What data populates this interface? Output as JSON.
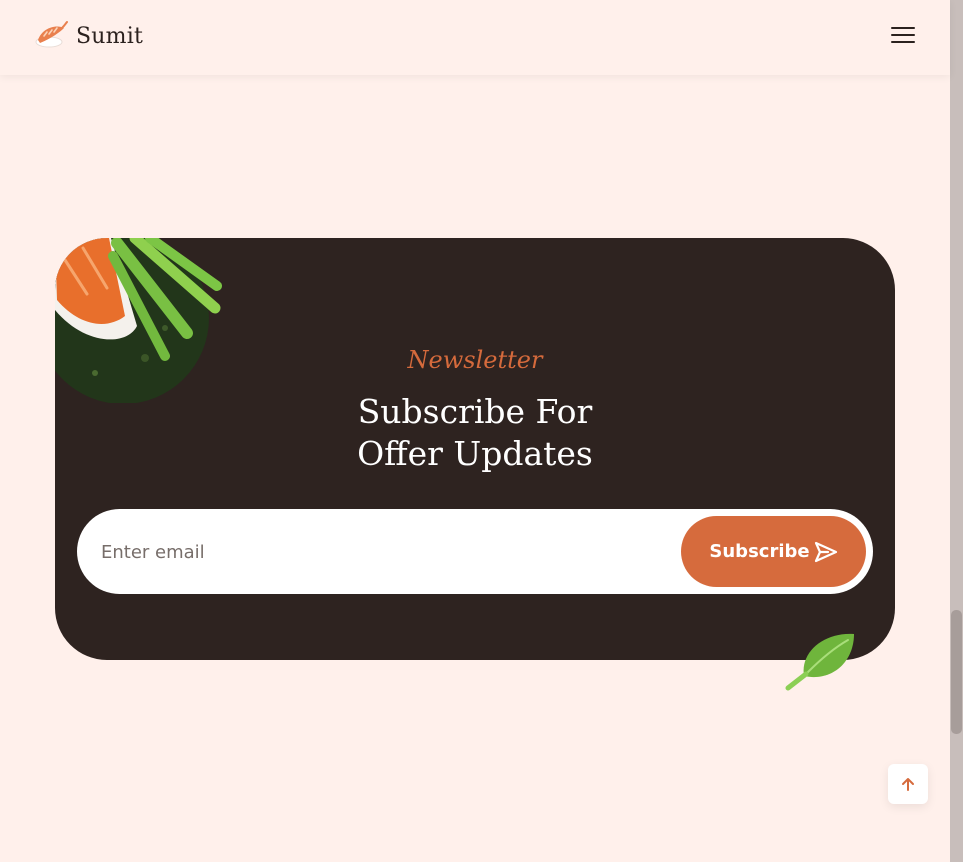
{
  "header": {
    "brand_name": "Sumit",
    "logo_icon": "shrimp-sushi-icon",
    "menu_icon": "hamburger-menu-icon"
  },
  "newsletter": {
    "eyebrow": "Newsletter",
    "title_line1": "Subscribe For",
    "title_line2": "Offer Updates",
    "email_placeholder": "Enter email",
    "email_value": "",
    "button_label": "Subscribe",
    "button_icon": "send-icon"
  },
  "scroll_top_icon": "arrow-up-icon",
  "colors": {
    "background": "#fff0eb",
    "panel": "#2e2320",
    "accent": "#d66b3d",
    "text_dark": "#2b211e"
  }
}
